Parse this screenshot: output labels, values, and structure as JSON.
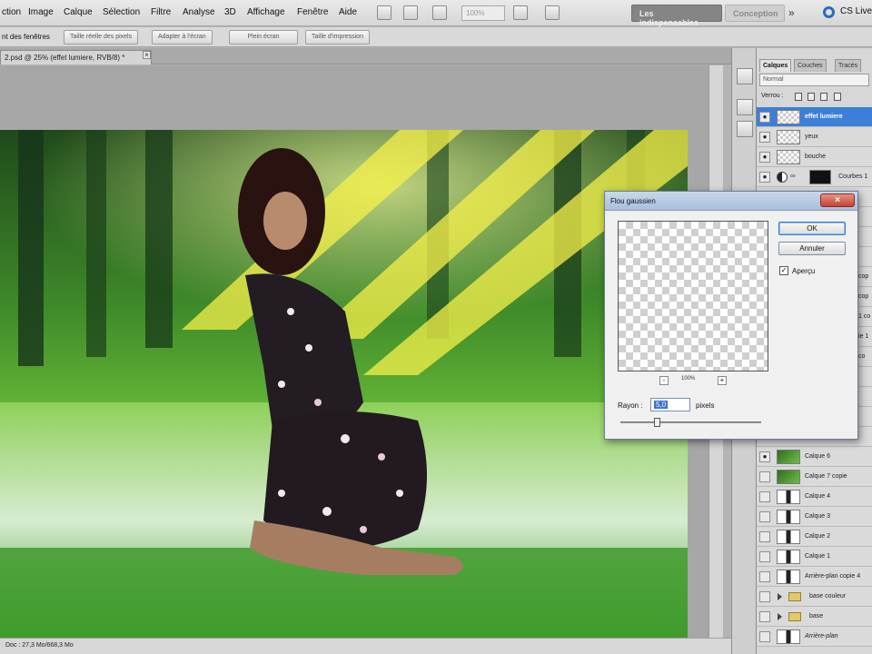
{
  "menubar": {
    "items": [
      "ction",
      "Image",
      "Calque",
      "Sélection",
      "Filtre",
      "Analyse",
      "3D",
      "Affichage",
      "Fenêtre",
      "Aide"
    ],
    "zoom": "100%",
    "workspace_essentials": "Les indispensables",
    "workspace_design": "Conception",
    "more": "»",
    "cs_live": "CS Live"
  },
  "optionsbar": {
    "label": "nt des fenêtres",
    "buttons": [
      "Taille réelle des pixels",
      "Adapter à l'écran",
      "Plein écran",
      "Taille d'impression"
    ]
  },
  "document": {
    "tab_title": "2.psd @ 25% (effet lumiere, RVB/8) *",
    "tab_close": "×",
    "status": "Doc : 27,3 Mo/668,3 Mo"
  },
  "layers_panel": {
    "tabs": [
      "Calques",
      "Couches",
      "Tracés"
    ],
    "blend_mode": "Normal",
    "lock_label": "Verrou :",
    "visible_eye": "●",
    "top_layers": [
      {
        "name": "effet lumiere",
        "thumb": "checker",
        "visible": true,
        "selected": true
      },
      {
        "name": "yeux",
        "thumb": "checker",
        "visible": true,
        "selected": false
      },
      {
        "name": "bouche",
        "thumb": "checker",
        "visible": true,
        "selected": false
      },
      {
        "name": "Courbes 1",
        "thumb": "black",
        "visible": true,
        "selected": false,
        "adjustment": true
      }
    ],
    "partial_labels": [
      "cop",
      "cop",
      "1 co",
      "ie 1",
      "co"
    ],
    "bottom_layers": [
      {
        "name": "Calque 6",
        "thumb": "green",
        "visible": true
      },
      {
        "name": "Calque 7 copie",
        "thumb": "green",
        "visible": false
      },
      {
        "name": "Calque 4",
        "thumb": "mask",
        "visible": false
      },
      {
        "name": "Calque 3",
        "thumb": "mask",
        "visible": false
      },
      {
        "name": "Calque 2",
        "thumb": "mask",
        "visible": false
      },
      {
        "name": "Calque 1",
        "thumb": "mask",
        "visible": false
      },
      {
        "name": "Arrière-plan copie 4",
        "thumb": "mask",
        "visible": false
      }
    ],
    "groups": [
      {
        "name": "base couleur",
        "visible": false
      },
      {
        "name": "base",
        "visible": false
      }
    ],
    "last_layer": {
      "name": "Arrière-plan",
      "thumb": "mask",
      "visible": false
    }
  },
  "dialog": {
    "title": "Flou gaussien",
    "close_symbol": "×",
    "ok": "OK",
    "cancel": "Annuler",
    "preview_label": "Aperçu",
    "preview_checked": "✓",
    "zoom_minus": "-",
    "zoom_plus": "+",
    "zoom_level": "100%",
    "radius_label": "Rayon :",
    "radius_value": "5,0",
    "radius_unit": "pixels"
  }
}
